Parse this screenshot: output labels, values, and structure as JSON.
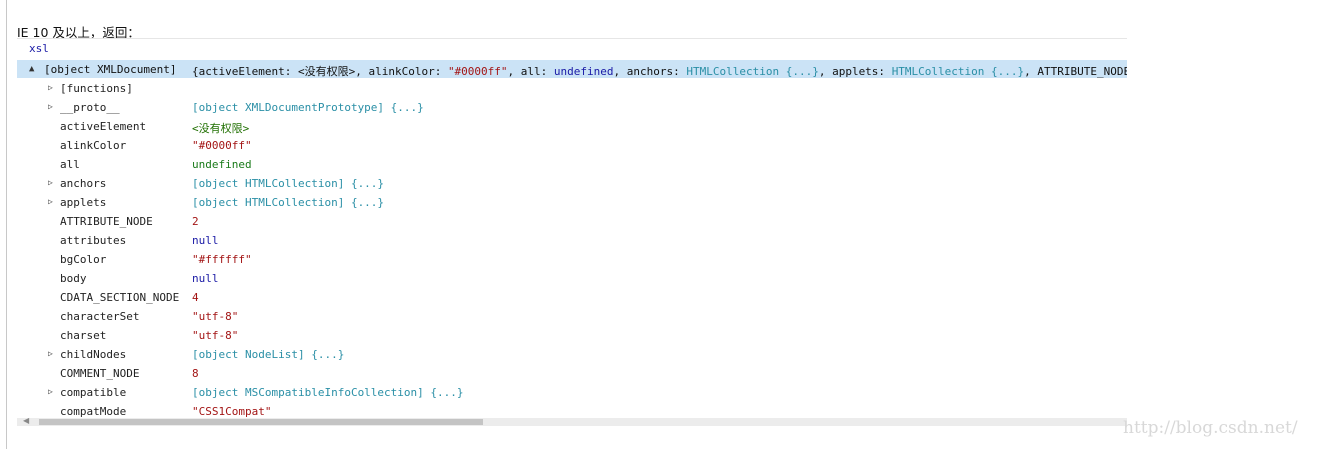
{
  "caption": "IE 10 及以上，返回：",
  "console": {
    "variable": "xsl",
    "summary": {
      "expand_icon": "▲",
      "label": "[object XMLDocument]",
      "preview_parts": [
        {
          "text": "{",
          "kind": "plain"
        },
        {
          "text": "activeElement",
          "kind": "plain"
        },
        {
          "text": ": ",
          "kind": "plain"
        },
        {
          "text": "<没有权限>",
          "kind": "plain"
        },
        {
          "text": ", alinkColor: ",
          "kind": "plain"
        },
        {
          "text": "\"#0000ff\"",
          "kind": "str"
        },
        {
          "text": ", all: ",
          "kind": "plain"
        },
        {
          "text": "undefined",
          "kind": "kw"
        },
        {
          "text": ", anchors: ",
          "kind": "plain"
        },
        {
          "text": "HTMLCollection {...}",
          "kind": "obj"
        },
        {
          "text": ", applets: ",
          "kind": "plain"
        },
        {
          "text": "HTMLCollection {...}",
          "kind": "obj"
        },
        {
          "text": ", ATTRIBUTE_NODE",
          "kind": "plain"
        }
      ]
    },
    "rows": [
      {
        "expandable": true,
        "name": "[functions]",
        "name_kind": "blue",
        "value": "",
        "value_kind": "plain"
      },
      {
        "expandable": true,
        "name": "__proto__",
        "name_kind": "plain",
        "value": "[object XMLDocumentPrototype] {...}",
        "value_kind": "obj"
      },
      {
        "expandable": false,
        "name": "activeElement",
        "name_kind": "plain",
        "value": "<没有权限>",
        "value_kind": "green"
      },
      {
        "expandable": false,
        "name": "alinkColor",
        "name_kind": "plain",
        "value": "\"#0000ff\"",
        "value_kind": "str"
      },
      {
        "expandable": false,
        "name": "all",
        "name_kind": "plain",
        "value": "undefined",
        "value_kind": "kw2"
      },
      {
        "expandable": true,
        "name": "anchors",
        "name_kind": "plain",
        "value": "[object HTMLCollection] {...}",
        "value_kind": "obj"
      },
      {
        "expandable": true,
        "name": "applets",
        "name_kind": "plain",
        "value": "[object HTMLCollection] {...}",
        "value_kind": "obj"
      },
      {
        "expandable": false,
        "name": "ATTRIBUTE_NODE",
        "name_kind": "plain",
        "value": "2",
        "value_kind": "num"
      },
      {
        "expandable": false,
        "name": "attributes",
        "name_kind": "plain",
        "value": "null",
        "value_kind": "kw"
      },
      {
        "expandable": false,
        "name": "bgColor",
        "name_kind": "plain",
        "value": "\"#ffffff\"",
        "value_kind": "str"
      },
      {
        "expandable": false,
        "name": "body",
        "name_kind": "plain",
        "value": "null",
        "value_kind": "kw"
      },
      {
        "expandable": false,
        "name": "CDATA_SECTION_NODE",
        "name_kind": "plain",
        "value": "4",
        "value_kind": "num"
      },
      {
        "expandable": false,
        "name": "characterSet",
        "name_kind": "plain",
        "value": "\"utf-8\"",
        "value_kind": "str"
      },
      {
        "expandable": false,
        "name": "charset",
        "name_kind": "plain",
        "value": "\"utf-8\"",
        "value_kind": "str"
      },
      {
        "expandable": true,
        "name": "childNodes",
        "name_kind": "plain",
        "value": "[object NodeList] {...}",
        "value_kind": "obj"
      },
      {
        "expandable": false,
        "name": "COMMENT_NODE",
        "name_kind": "plain",
        "value": "8",
        "value_kind": "num"
      },
      {
        "expandable": true,
        "name": "compatible",
        "name_kind": "plain",
        "value": "[object MSCompatibleInfoCollection] {...}",
        "value_kind": "obj"
      },
      {
        "expandable": false,
        "name": "compatMode",
        "name_kind": "plain",
        "value": "\"CSS1Compat\"",
        "value_kind": "str"
      }
    ]
  },
  "scrollbar": {
    "left_arrow": "◀",
    "thumb_fraction": 0.4
  },
  "watermark": "http://blog.csdn.net/",
  "colors": {
    "selected_row_bg": "#cbe3f6",
    "object_value": "#2a8fa6",
    "string_value": "#a31515",
    "keyword_value": "#1a1aa6",
    "permission_value": "#1f6f00"
  },
  "icons": {
    "expand_collapsed": "triangle-right-icon",
    "expand_open": "triangle-down-icon"
  }
}
